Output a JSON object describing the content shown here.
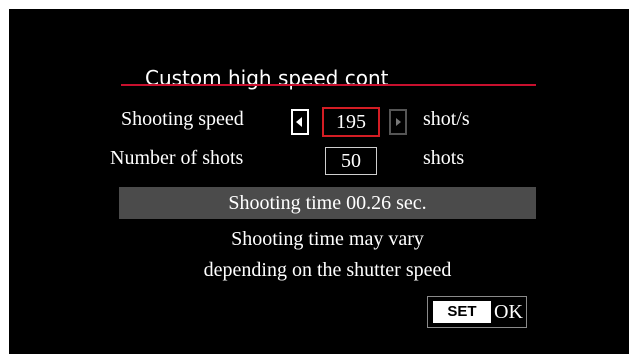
{
  "colors": {
    "screen_background": "#000000",
    "accent_red": "#d41d24",
    "info_bar": "#4b4b4b"
  },
  "menu": {
    "title": "Custom high speed cont"
  },
  "shooting_speed": {
    "label": "Shooting speed",
    "value": "195",
    "unit": "shot/s",
    "decrease_icon": "triangle-left",
    "increase_icon": "triangle-right"
  },
  "number_of_shots": {
    "label": "Number of shots",
    "value": "50",
    "unit": "shots"
  },
  "info": {
    "shooting_time": "Shooting time 00.26 sec.",
    "note_line1": "Shooting time may vary",
    "note_line2": "depending on the shutter speed"
  },
  "confirm": {
    "set_label": "SET",
    "ok_label": "OK"
  }
}
